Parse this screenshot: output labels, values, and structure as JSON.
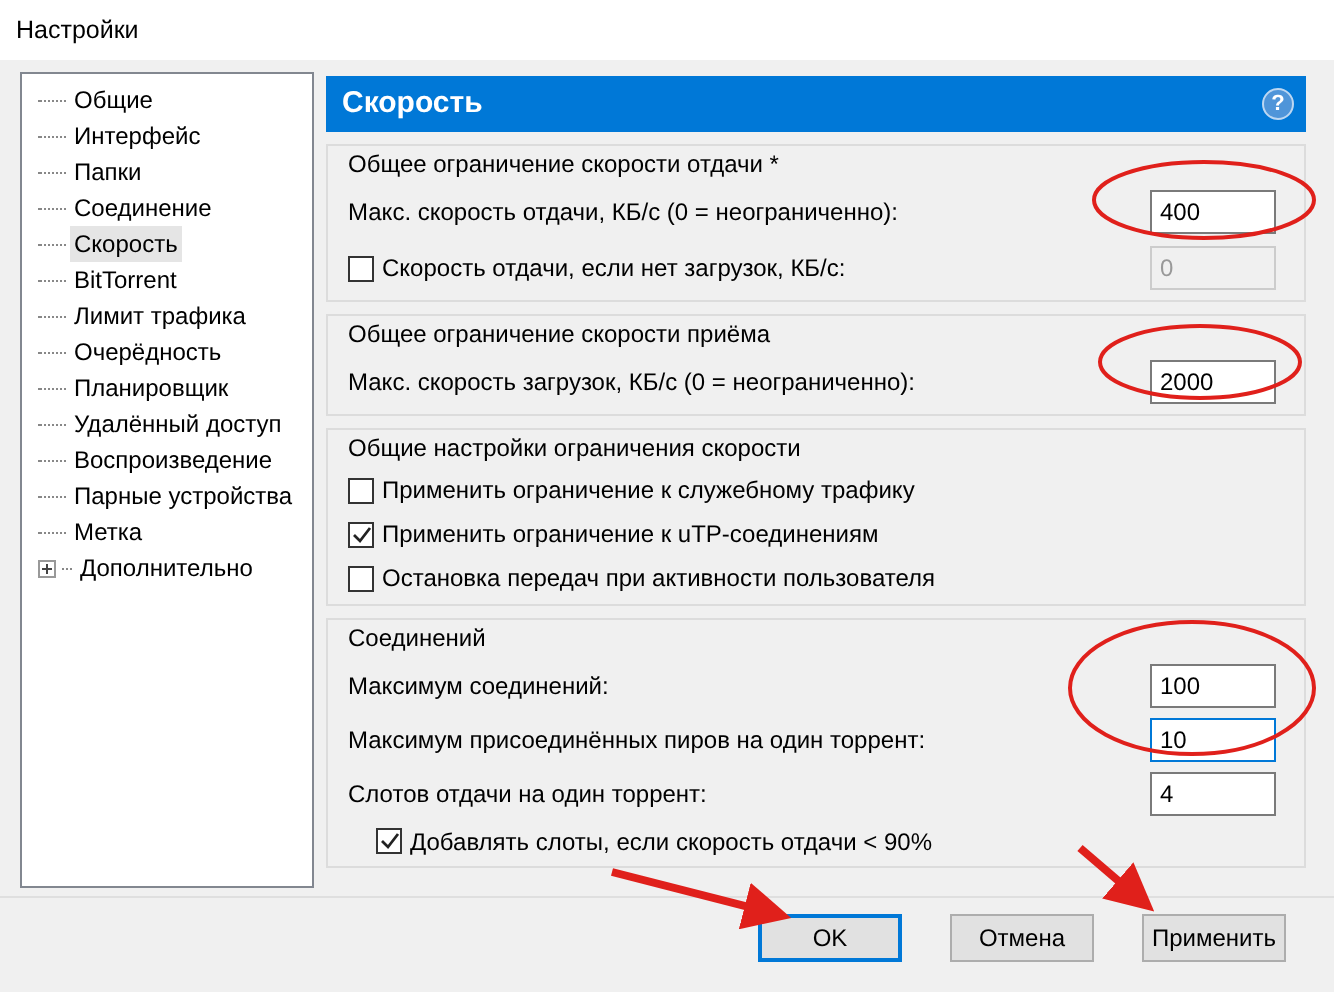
{
  "window": {
    "title": "Настройки"
  },
  "sidebar": {
    "items": [
      {
        "label": "Общие",
        "selected": false,
        "kind": "leaf"
      },
      {
        "label": "Интерфейс",
        "selected": false,
        "kind": "leaf"
      },
      {
        "label": "Папки",
        "selected": false,
        "kind": "leaf"
      },
      {
        "label": "Соединение",
        "selected": false,
        "kind": "leaf"
      },
      {
        "label": "Скорость",
        "selected": true,
        "kind": "leaf"
      },
      {
        "label": "BitTorrent",
        "selected": false,
        "kind": "leaf"
      },
      {
        "label": "Лимит трафика",
        "selected": false,
        "kind": "leaf"
      },
      {
        "label": "Очерёдность",
        "selected": false,
        "kind": "leaf"
      },
      {
        "label": "Планировщик",
        "selected": false,
        "kind": "leaf"
      },
      {
        "label": "Удалённый доступ",
        "selected": false,
        "kind": "leaf"
      },
      {
        "label": "Воспроизведение",
        "selected": false,
        "kind": "leaf"
      },
      {
        "label": "Парные устройства",
        "selected": false,
        "kind": "leaf"
      },
      {
        "label": "Метка",
        "selected": false,
        "kind": "leaf"
      },
      {
        "label": "Дополнительно",
        "selected": false,
        "kind": "folder"
      }
    ]
  },
  "panel": {
    "title": "Скорость",
    "help": "?",
    "groups": [
      {
        "title": "Общее ограничение скорости отдачи *",
        "rows": [
          {
            "kind": "field",
            "label": "Макс. скорость отдачи, КБ/с (0 = неограниченно):",
            "value": "400",
            "disabled": false,
            "focused": false
          },
          {
            "kind": "checkbox_field",
            "label": "Скорость отдачи, если нет загрузок, КБ/с:",
            "checked": false,
            "value": "0",
            "disabled": true,
            "focused": false
          }
        ]
      },
      {
        "title": "Общее ограничение скорости приёма",
        "rows": [
          {
            "kind": "field",
            "label": "Макс. скорость загрузок, КБ/с (0 = неограниченно):",
            "value": "2000",
            "disabled": false,
            "focused": false
          }
        ]
      },
      {
        "title": "Общие настройки ограничения скорости",
        "rows": [
          {
            "kind": "checkbox",
            "label": "Применить ограничение к служебному трафику",
            "checked": false
          },
          {
            "kind": "checkbox",
            "label": "Применить ограничение к uTP-соединениям",
            "checked": true
          },
          {
            "kind": "checkbox",
            "label": "Остановка передач при активности пользователя",
            "checked": false
          }
        ]
      },
      {
        "title": "Соединений",
        "rows": [
          {
            "kind": "field",
            "label": "Максимум соединений:",
            "value": "100",
            "disabled": false,
            "focused": false
          },
          {
            "kind": "field",
            "label": "Максимум присоединённых пиров на один торрент:",
            "value": "10",
            "disabled": false,
            "focused": true
          },
          {
            "kind": "field",
            "label": "Слотов отдачи на один торрент:",
            "value": "4",
            "disabled": false,
            "focused": false
          },
          {
            "kind": "sub_checkbox",
            "label": "Добавлять слоты, если скорость отдачи < 90%",
            "checked": true
          }
        ]
      }
    ]
  },
  "buttons": [
    {
      "label": "OK",
      "default": true
    },
    {
      "label": "Отмена",
      "default": false
    },
    {
      "label": "Применить",
      "default": false
    }
  ]
}
